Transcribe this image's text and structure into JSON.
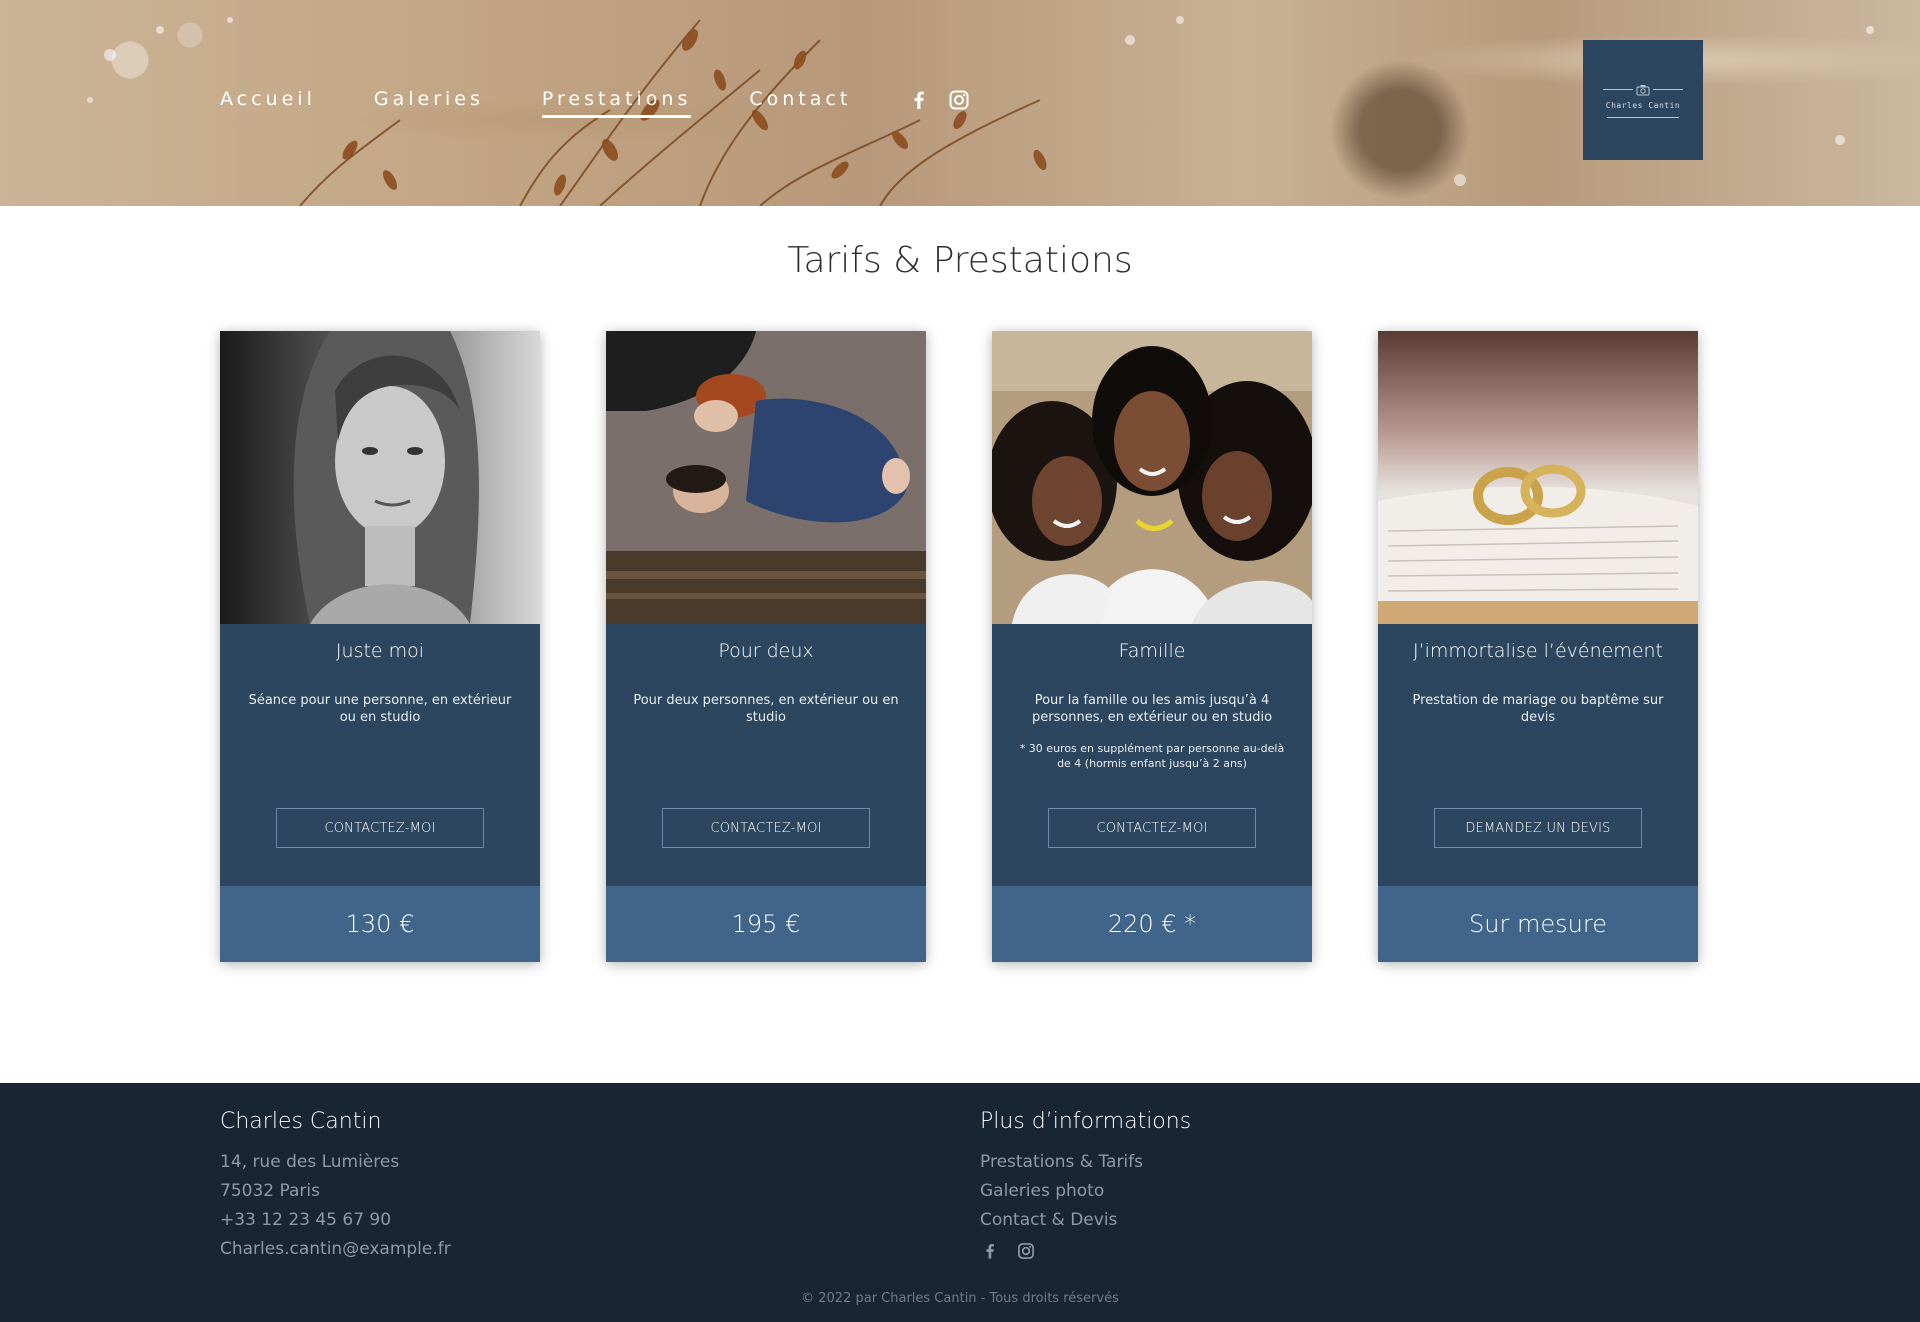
{
  "nav": {
    "links": [
      "Accueil",
      "Galeries",
      "Prestations",
      "Contact"
    ],
    "active_index": 2,
    "social_icons": [
      "facebook-icon",
      "instagram-icon"
    ]
  },
  "logo": {
    "text": "Charles Cantin",
    "icon": "camera-icon"
  },
  "page_title": "Tarifs & Prestations",
  "cards": [
    {
      "title": "Juste moi",
      "description": "Séance pour une personne, en extérieur ou en studio",
      "note": "",
      "button": "CONTACTEZ-MOI",
      "price": "130 €"
    },
    {
      "title": "Pour deux",
      "description": "Pour deux personnes, en extérieur ou en studio",
      "note": "",
      "button": "CONTACTEZ-MOI",
      "price": "195 €"
    },
    {
      "title": "Famille",
      "description": "Pour la famille ou les amis jusqu’à 4 personnes, en extérieur ou en studio",
      "note": "* 30 euros en supplément par personne au-delà de 4 (hormis enfant jusqu’à 2 ans)",
      "button": "CONTACTEZ-MOI",
      "price": "220 € *"
    },
    {
      "title": "J’immortalise l’événement",
      "description": "Prestation de mariage ou baptême sur devis",
      "note": "",
      "button": "DEMANDEZ UN DEVIS",
      "price": "Sur mesure"
    }
  ],
  "footer": {
    "contact": {
      "heading": "Charles Cantin",
      "address_line1": "14, rue des Lumières",
      "address_line2": "75032 Paris",
      "phone": "+33 12 23 45 67 90",
      "email": "Charles.cantin@example.fr"
    },
    "info": {
      "heading": "Plus d’informations",
      "links": [
        "Prestations & Tarifs",
        "Galeries photo",
        "Contact & Devis"
      ],
      "social_icons": [
        "facebook-icon",
        "instagram-icon"
      ]
    },
    "copyright": "© 2022 par Charles Cantin - Tous droits réservés"
  },
  "colors": {
    "card_bg": "#2d4660",
    "price_bg": "#41658a",
    "footer_bg": "#182533",
    "logo_bg": "#2d4660"
  }
}
